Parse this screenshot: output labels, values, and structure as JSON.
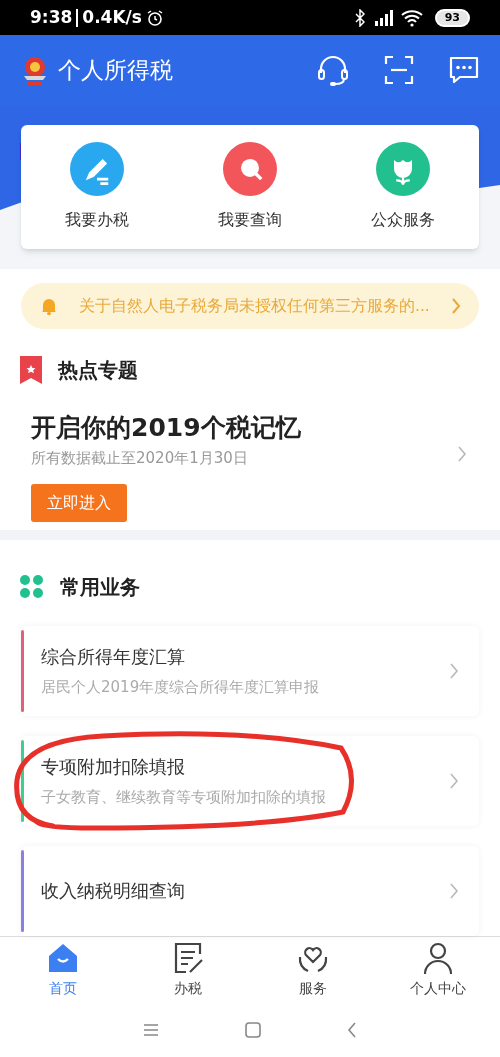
{
  "status_bar": {
    "time": "9:38",
    "speed": "0.4K/s",
    "battery": "93"
  },
  "header": {
    "title": "个人所得税"
  },
  "quick_actions": [
    {
      "label": "我要办税",
      "kind": "pencil",
      "color": "#29a8f0"
    },
    {
      "label": "我要查询",
      "kind": "search",
      "color": "#f2555a"
    },
    {
      "label": "公众服务",
      "kind": "flower",
      "color": "#22c08e"
    }
  ],
  "notice": {
    "text": "关于自然人电子税务局未授权任何第三方服务的..."
  },
  "hot_topics": {
    "title": "热点专题",
    "card": {
      "title": "开启你的2019个税记忆",
      "subtitle": "所有数据截止至2020年1月30日",
      "button": "立即进入"
    }
  },
  "common_services": {
    "title": "常用业务",
    "items": [
      {
        "title": "综合所得年度汇算",
        "subtitle": "居民个人2019年度综合所得年度汇算申报",
        "color": "#e0607e",
        "circled": false
      },
      {
        "title": "专项附加扣除填报",
        "subtitle": "子女教育、继续教育等专项附加扣除的填报",
        "color": "#3ecf8e",
        "circled": true
      },
      {
        "title": "收入纳税明细查询",
        "color": "#8a80e0",
        "circled": false
      }
    ]
  },
  "tabs": [
    {
      "label": "首页",
      "kind": "home",
      "selected": true
    },
    {
      "label": "办税",
      "kind": "form",
      "selected": false
    },
    {
      "label": "服务",
      "kind": "heart",
      "selected": false
    },
    {
      "label": "个人中心",
      "kind": "person",
      "selected": false
    }
  ]
}
